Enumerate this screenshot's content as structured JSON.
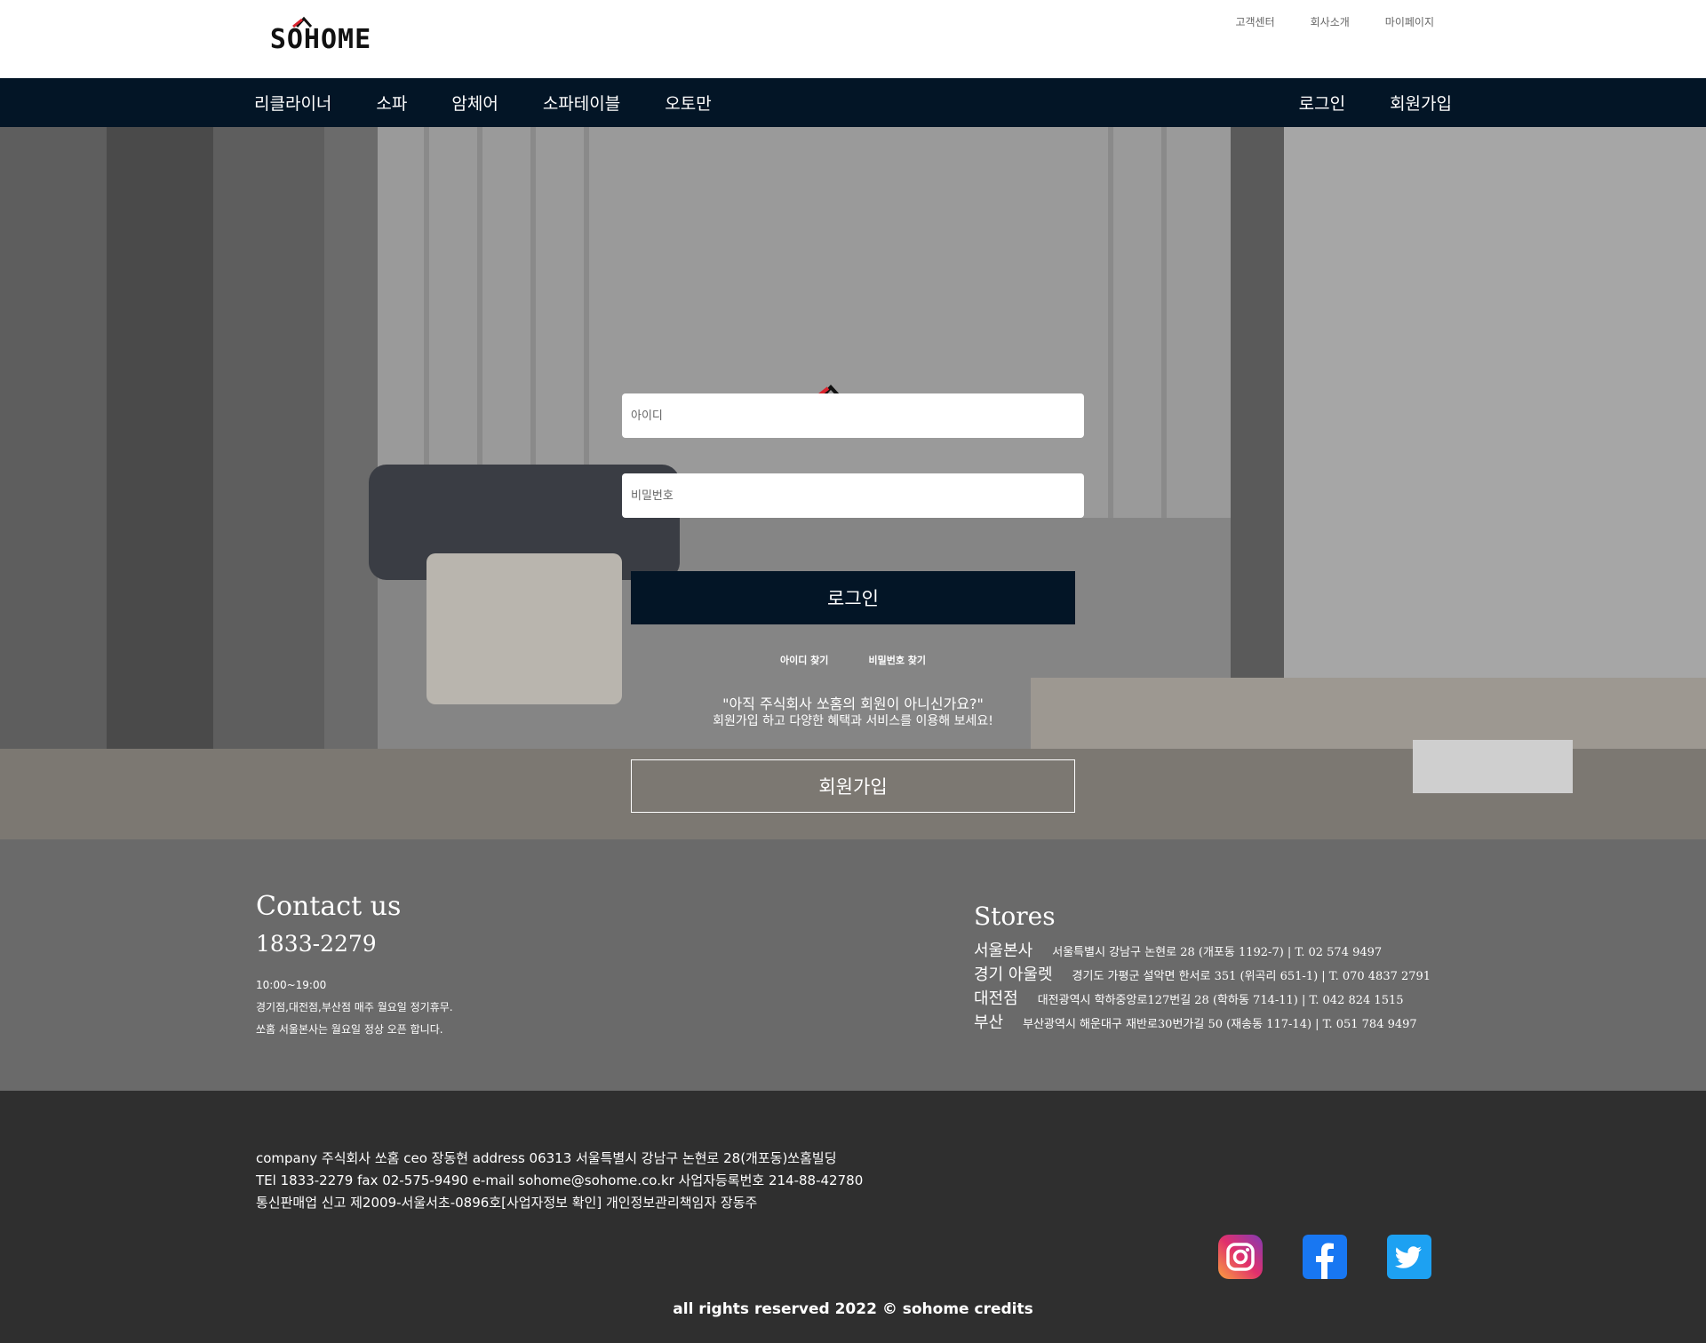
{
  "brand": {
    "logo_text": "SOHOME",
    "accent_color": "#d9232d"
  },
  "top_links": [
    "고객센터",
    "회사소개",
    "마이페이지"
  ],
  "nav": {
    "items": [
      "리클라이너",
      "소파",
      "암체어",
      "소파테이블",
      "오토만"
    ],
    "login": "로그인",
    "signup": "회원가입"
  },
  "login_form": {
    "id_placeholder": "아이디",
    "pw_placeholder": "비밀번호",
    "login_button": "로그인",
    "find_id": "아이디 찾기",
    "find_pw": "비밀번호 찾기",
    "promo_line1": "\"아직 주식회사 쏘홈의 회원이 아니신가요?\"",
    "promo_line2": "회원가입 하고 다양한 혜택과 서비스를 이용해 보세요!",
    "signup_button": "회원가입"
  },
  "contact": {
    "title": "Contact us",
    "phone": "1833-2279",
    "lines": [
      "10:00~19:00",
      "경기점,대전점,부산점 매주 월요일 정기휴무.",
      "쏘홈 서울본사는 월요일 정상 오픈 합니다."
    ]
  },
  "stores": {
    "title": "Stores",
    "items": [
      {
        "name": "서울본사",
        "detail": "서울특별시 강남구 논현로 28 (개포동 1192-7) | T. 02 574 9497"
      },
      {
        "name": "경기 아울렛",
        "detail": "경기도 가평군 설악면 한서로 351 (위곡리 651-1) | T. 070 4837 2791"
      },
      {
        "name": "대전점",
        "detail": "대전광역시 학하중앙로127번길 28 (학하동 714-11) | T. 042 824 1515"
      },
      {
        "name": "부산",
        "detail": "부산광역시 해운대구 재반로30번가길 50 (재송동 117-14) | T. 051 784 9497"
      }
    ]
  },
  "footer": {
    "lines": [
      "company 주식회사 쏘홈 ceo 장동현 address 06313 서울특별시 강남구 논현로 28(개포동)쏘홈빌딩",
      "TEl 1833-2279 fax 02-575-9490 e-mail sohome@sohome.co.kr 사업자등록번호 214-88-42780",
      "통신판매업 신고 제2009-서울서초-0896호[사업자정보 확인] 개인정보관리책임자 장동주"
    ],
    "social": [
      "instagram-icon",
      "facebook-icon",
      "twitter-icon"
    ],
    "copyright": "all rights reserved 2022 © sohome credits"
  }
}
